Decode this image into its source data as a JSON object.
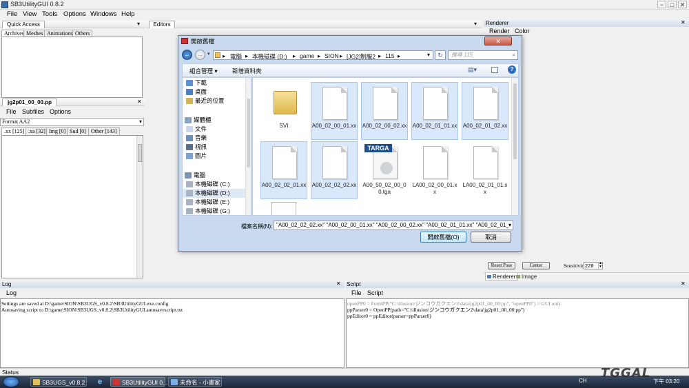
{
  "window": {
    "title": "SB3UtilityGUI 0.8.2",
    "buttons": [
      "−",
      "□",
      "✕"
    ]
  },
  "menu": {
    "items": [
      "File",
      "View",
      "Tools",
      "Options",
      "Windows",
      "Help"
    ]
  },
  "quick_access": {
    "title": "Quick Access",
    "tabs": [
      "Archives",
      "Meshes",
      "Animations",
      "Others"
    ]
  },
  "pp_panel": {
    "title": "jg2p01_00_00.pp",
    "menu": [
      "File",
      "Subfiles",
      "Options"
    ],
    "format": "Format AA2",
    "tabs": [
      ".xx [125]",
      ".xa [32]",
      "Img [0]",
      "Sud [0]",
      "Other [143]"
    ]
  },
  "editors": {
    "title": "Editors"
  },
  "renderer": {
    "title": "Renderer",
    "menu": [
      "Render",
      "Color"
    ],
    "reset_pose": "Reset Pose",
    "center": "Center",
    "sensitivity_label": "Sensitivity",
    "sensitivity_value": "228",
    "tabs": [
      "Renderer",
      "Image"
    ]
  },
  "log": {
    "title": "Log",
    "tab": "Log",
    "lines": [
      "Settings are saved at D:\\game\\SION\\SB3UGS_v0.8.2\\SB3UtilityGUI.exe.config",
      "Autosaving script to D:\\game\\SION\\SB3UGS_v0.8.2\\SB3UtilityGUI.autosavescript.txt"
    ]
  },
  "script": {
    "title": "Script",
    "menu": [
      "File",
      "Script"
    ],
    "lines": [
      "openPP0 = FormPP(\"C:\\illusion\\ジンコウガクエン2\\data\\jg2p01_00_00.pp\", \"openPP0\") // GUI only",
      "ppParser0 = OpenPP(path=\"C:\\illusion\\ジンコウガクエン2\\data\\jg2p01_00_00.pp\")",
      "ppEditor0 = ppEditor(parser=ppParser0)"
    ]
  },
  "status": {
    "text": "Status"
  },
  "dialog": {
    "title": "開啟舊檔",
    "close": "✕",
    "breadcrumb": [
      "電腦",
      "本機磁碟 (D:)",
      "game",
      "SION",
      "[JG2]制服2",
      "115"
    ],
    "search_placeholder": "搜尋 115",
    "toolbar": {
      "organize": "組合管理 ▾",
      "new_folder": "新增資料夾"
    },
    "nav": [
      {
        "label": "下載",
        "group": "fav"
      },
      {
        "label": "桌面",
        "group": "fav"
      },
      {
        "label": "最近的位置",
        "group": "fav"
      },
      {
        "label": "媒體櫃",
        "group": "lib"
      },
      {
        "label": "文件",
        "group": "lib"
      },
      {
        "label": "音樂",
        "group": "lib"
      },
      {
        "label": "視訊",
        "group": "lib"
      },
      {
        "label": "圖片",
        "group": "lib"
      },
      {
        "label": "電腦",
        "group": "pc"
      },
      {
        "label": "本機磁碟 (C:)",
        "group": "pc"
      },
      {
        "label": "本機磁碟 (D:)",
        "group": "pc"
      },
      {
        "label": "本機磁碟 (E:)",
        "group": "pc"
      },
      {
        "label": "本機磁碟 (G:)",
        "group": "pc"
      }
    ],
    "files": [
      {
        "name": "SVI",
        "kind": "folder",
        "selected": false
      },
      {
        "name": "A00_02_00_01.xx",
        "kind": "doc",
        "selected": true
      },
      {
        "name": "A00_02_00_02.xx",
        "kind": "doc",
        "selected": true
      },
      {
        "name": "A00_02_01_01.xx",
        "kind": "doc",
        "selected": true
      },
      {
        "name": "A00_02_01_02.xx",
        "kind": "doc",
        "selected": true
      },
      {
        "name": "A00_02_02_01.xx",
        "kind": "doc",
        "selected": true
      },
      {
        "name": "A00_02_02_02.xx",
        "kind": "doc",
        "selected": true
      },
      {
        "name": "A00_50_02_00_00.tga",
        "kind": "tga",
        "badge": "TARGA",
        "selected": false
      },
      {
        "name": "LA00_02_00_01.xx",
        "kind": "doc",
        "selected": false
      },
      {
        "name": "LA00_02_01_01.xx",
        "kind": "doc",
        "selected": false
      }
    ],
    "filename_label": "檔案名稱(N):",
    "filename_value": "\"A00_02_02_02.xx\" \"A00_02_00_01.xx\" \"A00_02_00_02.xx\" \"A00_02_01_01.xx\" \"A00_02_01_",
    "open_button": "開啟舊檔(O)",
    "cancel_button": "取消"
  },
  "taskbar": {
    "items": [
      "SB3UGS_v0.8.2",
      "SB3UtilityGUI 0...",
      "未命名 - 小畫家"
    ],
    "lang": "CH",
    "time": "下午 03:20"
  },
  "watermark": {
    "text": "TGGAL"
  },
  "colors": {
    "selection": "#d9e8fb",
    "dialog_frame": "#c9d9ee",
    "taskbar": "#1b2638"
  }
}
